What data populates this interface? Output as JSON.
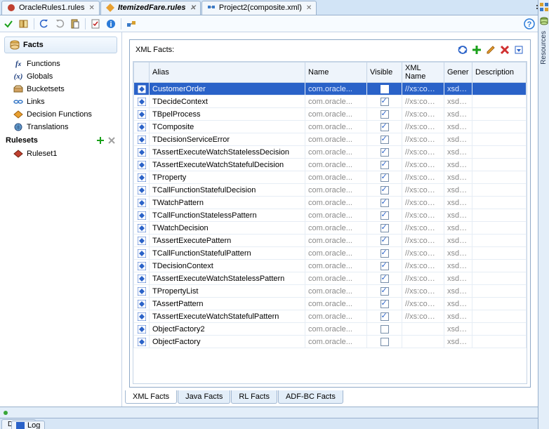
{
  "tabs": [
    {
      "label": "OracleRules1.rules",
      "active": false
    },
    {
      "label": "ItemizedFare.rules",
      "active": true
    },
    {
      "label": "Project2(composite.xml)",
      "active": false
    }
  ],
  "right_rail_label": "Resources",
  "left": {
    "facts_header": "Facts",
    "items": [
      {
        "key": "functions",
        "label": "Functions"
      },
      {
        "key": "globals",
        "label": "Globals"
      },
      {
        "key": "bucketsets",
        "label": "Bucketsets"
      },
      {
        "key": "links",
        "label": "Links"
      },
      {
        "key": "decision",
        "label": "Decision Functions"
      },
      {
        "key": "translations",
        "label": "Translations"
      }
    ],
    "rulesets_header": "Rulesets",
    "rulesets": [
      {
        "label": "Ruleset1"
      }
    ]
  },
  "content": {
    "title": "XML Facts:",
    "columns": {
      "alias": "Alias",
      "name": "Name",
      "visible": "Visible",
      "xmlname": "XML Name",
      "generated": "Gener",
      "description": "Description"
    },
    "rows": [
      {
        "alias": "CustomerOrder",
        "name": "com.oracle...",
        "visible": true,
        "xmlname": "//xs:co…",
        "gen": "xsd…",
        "desc": "",
        "selected": true
      },
      {
        "alias": "TDecideContext",
        "name": "com.oracle...",
        "visible": true,
        "xmlname": "//xs:co…",
        "gen": "xsd…",
        "desc": ""
      },
      {
        "alias": "TBpelProcess",
        "name": "com.oracle...",
        "visible": true,
        "xmlname": "//xs:co…",
        "gen": "xsd…",
        "desc": ""
      },
      {
        "alias": "TComposite",
        "name": "com.oracle...",
        "visible": true,
        "xmlname": "//xs:co…",
        "gen": "xsd…",
        "desc": ""
      },
      {
        "alias": "TDecisionServiceError",
        "name": "com.oracle...",
        "visible": true,
        "xmlname": "//xs:co…",
        "gen": "xsd…",
        "desc": ""
      },
      {
        "alias": "TAssertExecuteWatchStatelessDecision",
        "name": "com.oracle...",
        "visible": true,
        "xmlname": "//xs:co…",
        "gen": "xsd…",
        "desc": ""
      },
      {
        "alias": "TAssertExecuteWatchStatefulDecision",
        "name": "com.oracle...",
        "visible": true,
        "xmlname": "//xs:co…",
        "gen": "xsd…",
        "desc": ""
      },
      {
        "alias": "TProperty",
        "name": "com.oracle...",
        "visible": true,
        "xmlname": "//xs:co…",
        "gen": "xsd…",
        "desc": ""
      },
      {
        "alias": "TCallFunctionStatefulDecision",
        "name": "com.oracle...",
        "visible": true,
        "xmlname": "//xs:co…",
        "gen": "xsd…",
        "desc": ""
      },
      {
        "alias": "TWatchPattern",
        "name": "com.oracle...",
        "visible": true,
        "xmlname": "//xs:co…",
        "gen": "xsd…",
        "desc": ""
      },
      {
        "alias": "TCallFunctionStatelessPattern",
        "name": "com.oracle...",
        "visible": true,
        "xmlname": "//xs:co…",
        "gen": "xsd…",
        "desc": ""
      },
      {
        "alias": "TWatchDecision",
        "name": "com.oracle...",
        "visible": true,
        "xmlname": "//xs:co…",
        "gen": "xsd…",
        "desc": ""
      },
      {
        "alias": "TAssertExecutePattern",
        "name": "com.oracle...",
        "visible": true,
        "xmlname": "//xs:co…",
        "gen": "xsd…",
        "desc": ""
      },
      {
        "alias": "TCallFunctionStatefulPattern",
        "name": "com.oracle...",
        "visible": true,
        "xmlname": "//xs:co…",
        "gen": "xsd…",
        "desc": ""
      },
      {
        "alias": "TDecisionContext",
        "name": "com.oracle...",
        "visible": true,
        "xmlname": "//xs:co…",
        "gen": "xsd…",
        "desc": ""
      },
      {
        "alias": "TAssertExecuteWatchStatelessPattern",
        "name": "com.oracle...",
        "visible": true,
        "xmlname": "//xs:co…",
        "gen": "xsd…",
        "desc": ""
      },
      {
        "alias": "TPropertyList",
        "name": "com.oracle...",
        "visible": true,
        "xmlname": "//xs:co…",
        "gen": "xsd…",
        "desc": ""
      },
      {
        "alias": "TAssertPattern",
        "name": "com.oracle...",
        "visible": true,
        "xmlname": "//xs:co…",
        "gen": "xsd…",
        "desc": ""
      },
      {
        "alias": "TAssertExecuteWatchStatefulPattern",
        "name": "com.oracle...",
        "visible": true,
        "xmlname": "//xs:co…",
        "gen": "xsd…",
        "desc": ""
      },
      {
        "alias": "ObjectFactory2",
        "name": "com.oracle...",
        "visible": false,
        "xmlname": "",
        "gen": "xsd…",
        "desc": ""
      },
      {
        "alias": "ObjectFactory",
        "name": "com.oracle...",
        "visible": false,
        "xmlname": "",
        "gen": "xsd…",
        "desc": ""
      }
    ],
    "sub_tabs": [
      {
        "label": "XML Facts",
        "active": true
      },
      {
        "label": "Java Facts"
      },
      {
        "label": "RL Facts"
      },
      {
        "label": "ADF-BC Facts"
      }
    ]
  },
  "bottom": {
    "design_label": "Design",
    "log_tab": "Log"
  }
}
